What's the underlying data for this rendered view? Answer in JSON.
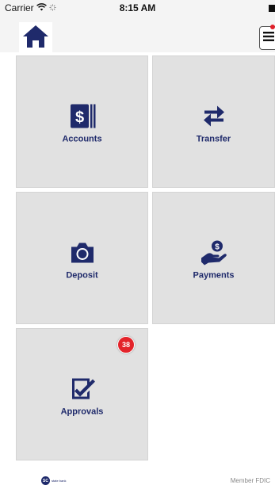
{
  "status_bar": {
    "carrier": "Carrier",
    "time": "8:15 AM"
  },
  "header": {
    "home_icon": "home-icon",
    "menu_icon": "hamburger-menu-icon"
  },
  "tiles": [
    {
      "label": "Accounts",
      "icon": "dollar-bill-icon"
    },
    {
      "label": "Transfer",
      "icon": "transfer-arrows-icon"
    },
    {
      "label": "Deposit",
      "icon": "camera-icon"
    },
    {
      "label": "Payments",
      "icon": "hand-coin-icon"
    },
    {
      "label": "Approvals",
      "icon": "checkbox-pencil-icon",
      "badge": "38"
    }
  ],
  "footer": {
    "logo_mark": "SC",
    "logo_text": "state bank",
    "fdic": "Member FDIC"
  },
  "colors": {
    "brand": "#1f2a6b",
    "tile_bg": "#e1e1e1",
    "badge": "#e3242b"
  }
}
